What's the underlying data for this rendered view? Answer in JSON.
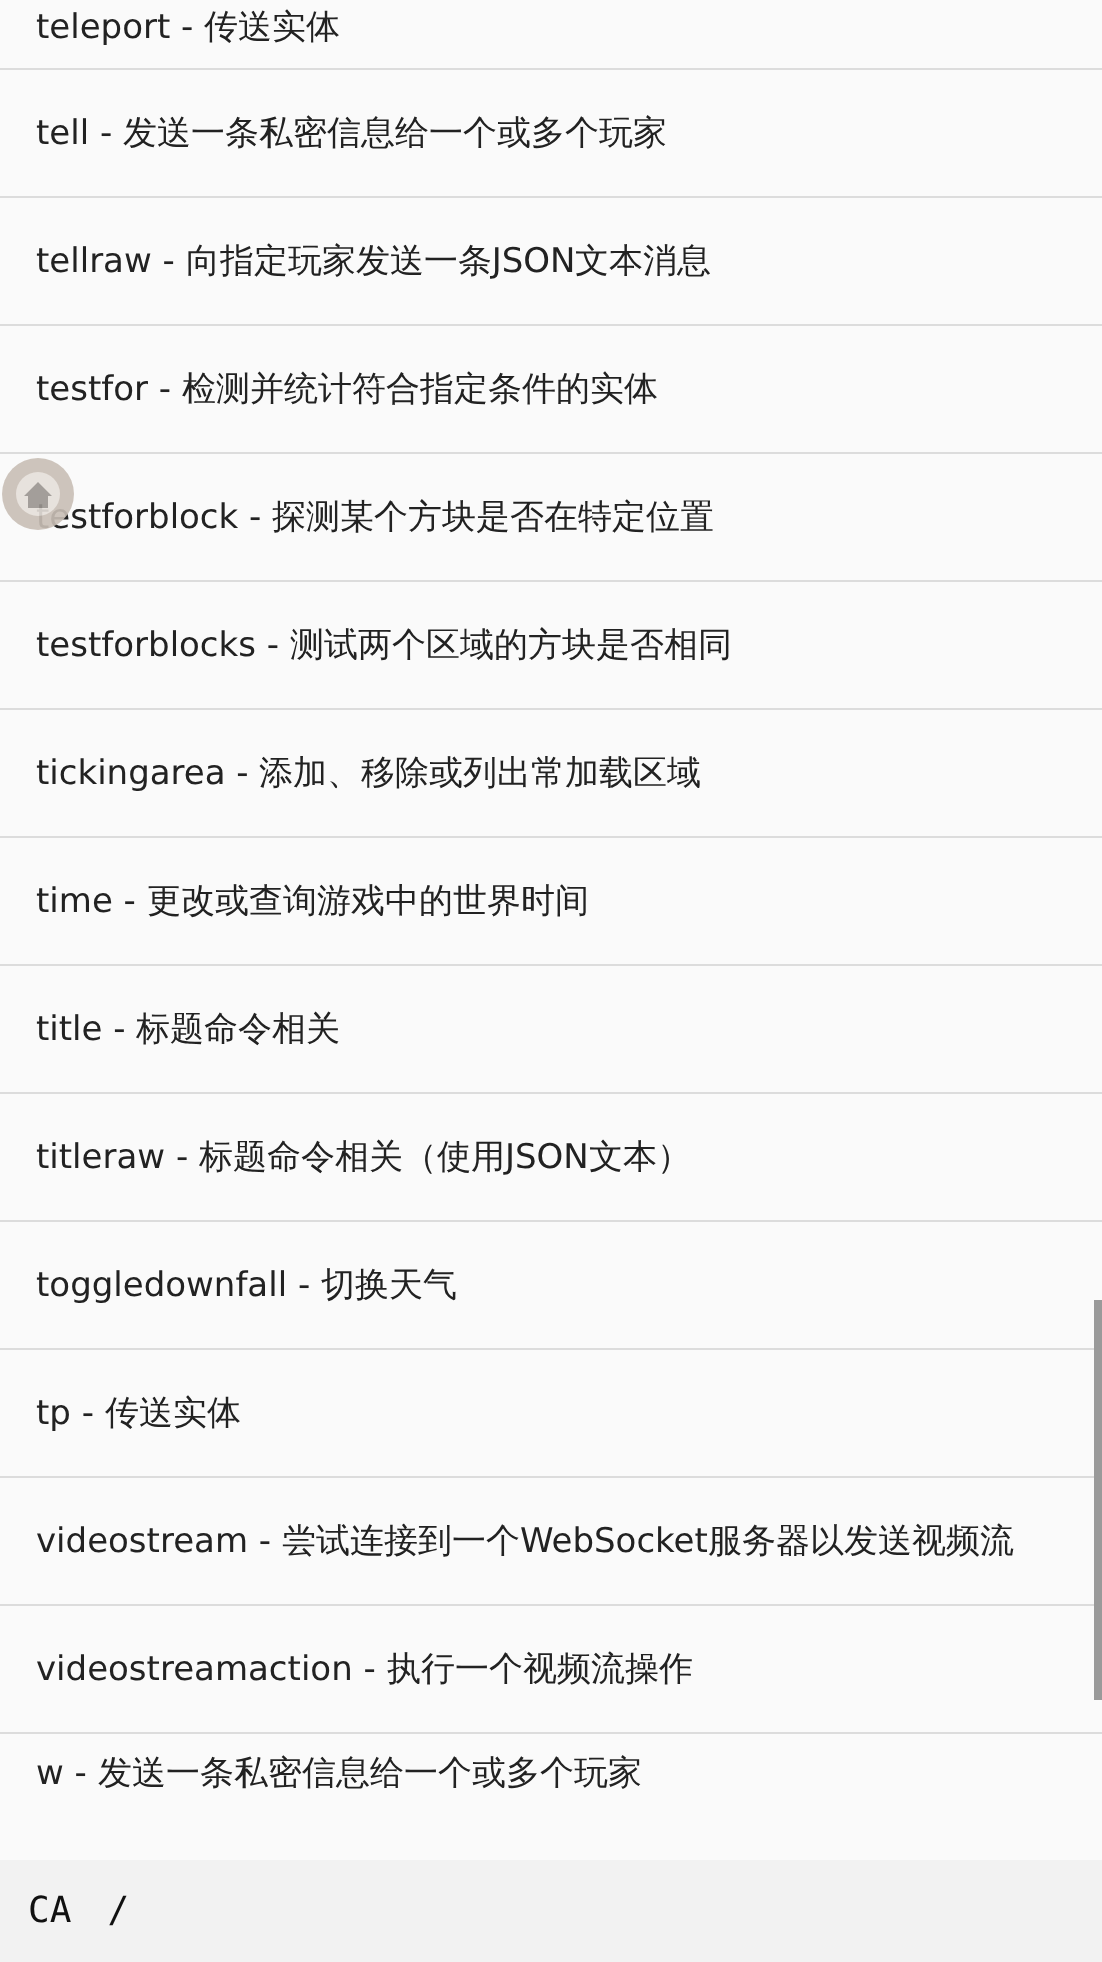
{
  "commands": [
    "teleport - 传送实体",
    "tell - 发送一条私密信息给一个或多个玩家",
    "tellraw - 向指定玩家发送一条JSON文本消息",
    "testfor - 检测并统计符合指定条件的实体",
    "testforblock - 探测某个方块是否在特定位置",
    "testforblocks - 测试两个区域的方块是否相同",
    "tickingarea - 添加、移除或列出常加载区域",
    "time - 更改或查询游戏中的世界时间",
    "title - 标题命令相关",
    "titleraw - 标题命令相关（使用JSON文本）",
    "toggledownfall - 切换天气",
    "tp - 传送实体",
    "videostream - 尝试连接到一个WebSocket服务器以发送视频流",
    "videostreamaction - 执行一个视频流操作",
    "w - 发送一条私密信息给一个或多个玩家"
  ],
  "input_bar": {
    "button": "CA",
    "value": "/"
  }
}
